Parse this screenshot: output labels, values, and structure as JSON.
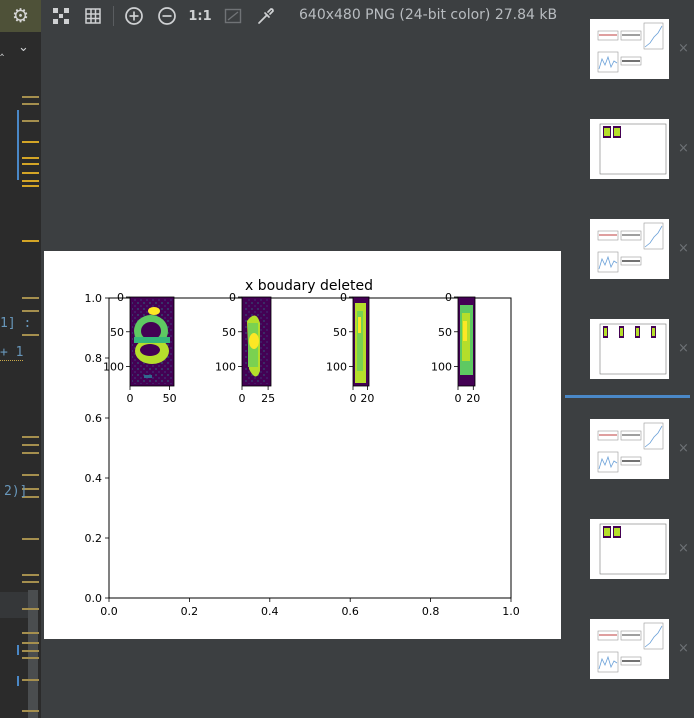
{
  "toolbar": {
    "image_info": "640x480 PNG (24-bit color) 27.84 kB",
    "zoom_actual_label": "1:1",
    "icons": [
      "gear-icon",
      "fit-window-icon",
      "grid-icon",
      "zoom-in-icon",
      "zoom-out-icon",
      "actual-size-icon",
      "background-icon",
      "color-picker-icon"
    ]
  },
  "editor": {
    "fragments": [
      "1] :",
      "+ 1",
      "2)]"
    ]
  },
  "figure": {
    "main_title": "x boudary deleted",
    "main_x_ticks": [
      "0.0",
      "0.2",
      "0.4",
      "0.6",
      "0.8",
      "1.0"
    ],
    "main_y_ticks": [
      "0.0",
      "0.2",
      "0.4",
      "0.6",
      "0.8",
      "1.0"
    ],
    "subplots": [
      {
        "y_ticks": [
          "0",
          "50",
          "100"
        ],
        "x_ticks": [
          "0",
          "50"
        ]
      },
      {
        "y_ticks": [
          "0",
          "50",
          "100"
        ],
        "x_ticks": [
          "0",
          "25"
        ]
      },
      {
        "y_ticks": [
          "0",
          "50",
          "100"
        ],
        "x_ticks": [
          "0",
          "20"
        ]
      },
      {
        "y_ticks": [
          "0",
          "50",
          "100"
        ],
        "x_ticks": [
          "0",
          "20"
        ]
      }
    ]
  },
  "thumbnails": {
    "close_glyph": "×",
    "items": [
      {
        "kind": "plots"
      },
      {
        "kind": "chart"
      },
      {
        "kind": "plots"
      },
      {
        "kind": "chart4"
      },
      {
        "kind": "plots"
      },
      {
        "kind": "chart2"
      },
      {
        "kind": "plots"
      }
    ]
  },
  "colors": {
    "viridis_dark": "#440154",
    "viridis_blue": "#3b528b",
    "viridis_green": "#5ec962",
    "viridis_yellow": "#fde725",
    "selection": "#4a88c7"
  }
}
